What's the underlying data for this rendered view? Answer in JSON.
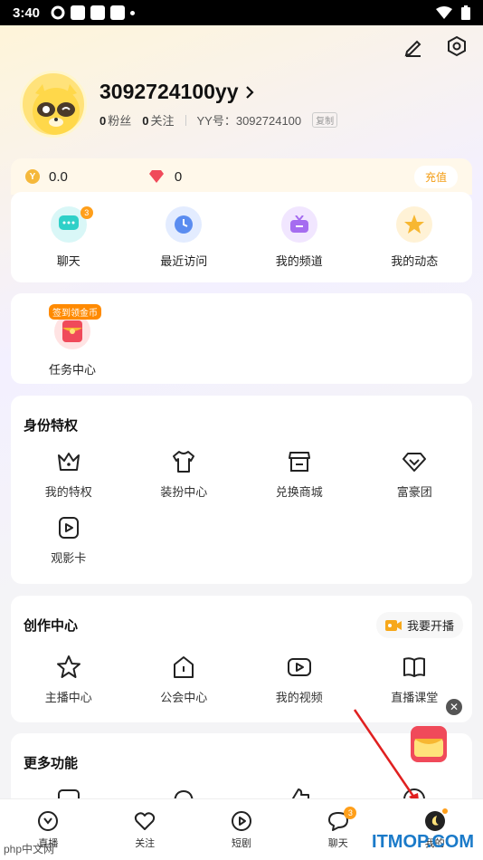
{
  "status": {
    "time": "3:40"
  },
  "profile": {
    "username": "3092724100yy",
    "fans_count": "0",
    "fans_label": "粉丝",
    "follow_count": "0",
    "follow_label": "关注",
    "yy_id": "YY号：3092724100",
    "copy_label": "复制"
  },
  "wallet": {
    "coins": "0.0",
    "gems": "0",
    "charge_label": "充值"
  },
  "quick": [
    {
      "label": "聊天",
      "badge": "3"
    },
    {
      "label": "最近访问"
    },
    {
      "label": "我的频道"
    },
    {
      "label": "我的动态"
    }
  ],
  "task": {
    "tag": "签到领金币",
    "label": "任务中心"
  },
  "identity": {
    "title": "身份特权",
    "items": [
      "我的特权",
      "装扮中心",
      "兑换商城",
      "富豪团",
      "观影卡"
    ]
  },
  "create": {
    "title": "创作中心",
    "live_label": "我要开播",
    "items": [
      "主播中心",
      "公会中心",
      "我的视频",
      "直播课堂"
    ]
  },
  "more": {
    "title": "更多功能"
  },
  "tabs": [
    {
      "label": "直播"
    },
    {
      "label": "关注"
    },
    {
      "label": "短剧"
    },
    {
      "label": "聊天",
      "badge": "3"
    },
    {
      "label": "我的"
    }
  ],
  "watermark": {
    "site": "ITMOP.COM",
    "left": "php中文网"
  },
  "colors": {
    "accent": "#ff9f1a",
    "brand": "#ffe27a"
  }
}
